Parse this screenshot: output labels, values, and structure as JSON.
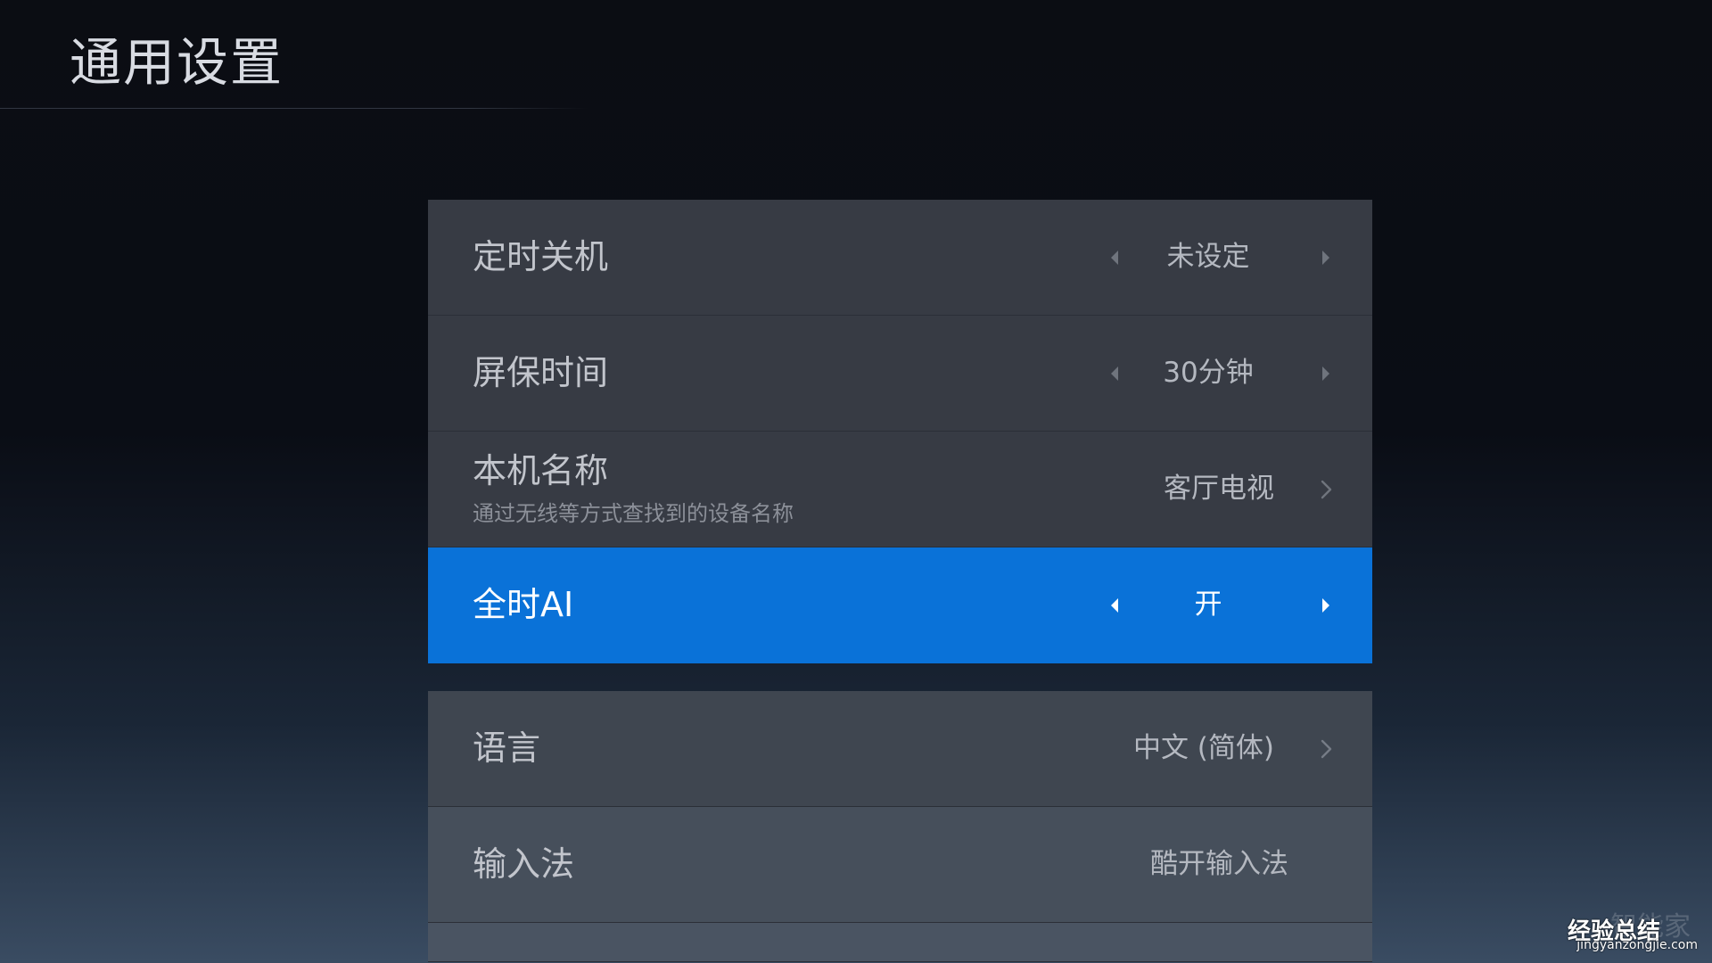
{
  "page": {
    "title": "通用设置"
  },
  "settings": {
    "sleep_timer": {
      "label": "定时关机",
      "value": "未设定"
    },
    "screensaver": {
      "label": "屏保时间",
      "value": "30分钟"
    },
    "device_name": {
      "label": "本机名称",
      "description": "通过无线等方式查找到的设备名称",
      "value": "客厅电视"
    },
    "always_on_ai": {
      "label": "全时AI",
      "value": "开"
    },
    "language": {
      "label": "语言",
      "value": "中文 (简体)"
    },
    "input_method": {
      "label": "输入法",
      "value": "酷开输入法"
    }
  },
  "watermark": {
    "background_text": "智能家",
    "main_text": "经验总结",
    "url": "jingyanzongjie.com"
  },
  "colors": {
    "focus_accent": "#0a72d8",
    "row_background": "#373b44"
  }
}
